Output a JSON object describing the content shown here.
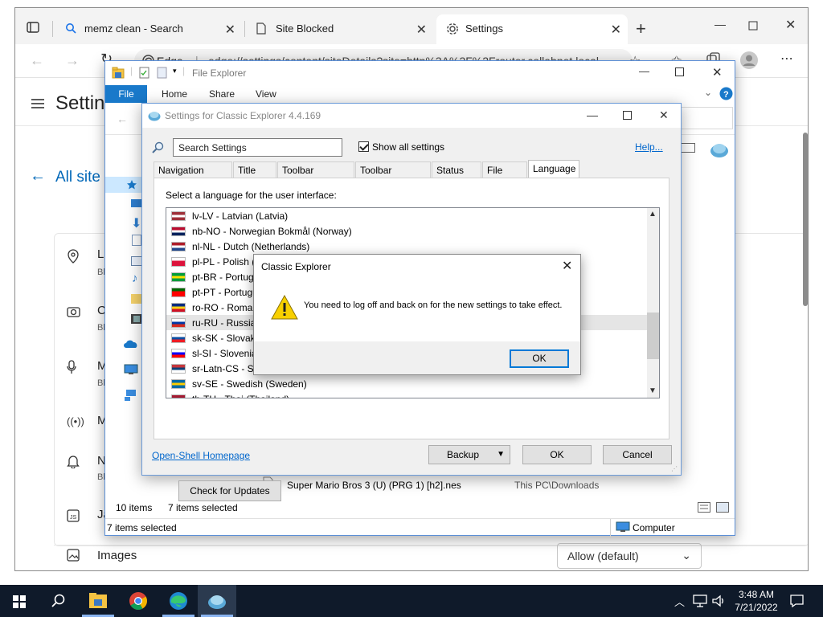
{
  "browser": {
    "tabs": [
      {
        "label": "memz clean - Search",
        "icon": "search-icon"
      },
      {
        "label": "Site Blocked",
        "icon": "page-icon"
      },
      {
        "label": "Settings",
        "icon": "gear-icon"
      }
    ],
    "address": {
      "brand": "Edge",
      "url": "edge://settings/content/siteDetails?site=http%3A%2F%2Frouter.collabnet.local"
    },
    "settings_title": "Settin",
    "all_sites": "All site",
    "permissions": [
      {
        "label": "Lo",
        "sub": "Bl"
      },
      {
        "label": "C",
        "sub": "Bl"
      },
      {
        "label": "M",
        "sub": "Bl"
      },
      {
        "label": "M",
        "sub": ""
      },
      {
        "label": "N",
        "sub": "Bl"
      },
      {
        "label": "Ja",
        "sub": ""
      }
    ],
    "images_label": "Images",
    "images_value": "Allow (default)"
  },
  "file_explorer": {
    "title": "File Explorer",
    "ribbon": {
      "file": "File",
      "home": "Home",
      "share": "Share",
      "view": "View"
    },
    "row_name": "Super Mario Bros 3 (U) (PRG 1) [h2].nes",
    "row_location": "This PC\\Downloads",
    "item_count": "10 items",
    "selected_count": "7 items selected",
    "status_selected": "7 items selected",
    "status_location": "Computer"
  },
  "classic_settings": {
    "title": "Settings for Classic Explorer 4.4.169",
    "search_placeholder": "Search Settings",
    "show_all": "Show all settings",
    "help": "Help...",
    "tabs": [
      "Navigation Pane",
      "Title Bar",
      "Toolbar Settings",
      "Toolbar Buttons",
      "Status Bar",
      "File Pane",
      "Language"
    ],
    "prompt": "Select a language for the user interface:",
    "languages": [
      {
        "label": "lv-LV - Latvian (Latvia)",
        "flag": [
          "#9e3039",
          "#ffffff",
          "#9e3039"
        ]
      },
      {
        "label": "nb-NO - Norwegian Bokmål (Norway)",
        "flag": [
          "#ba0c2f",
          "#ffffff",
          "#00205b"
        ]
      },
      {
        "label": "nl-NL - Dutch (Netherlands)",
        "flag": [
          "#ae1c28",
          "#ffffff",
          "#21468b"
        ]
      },
      {
        "label": "pl-PL - Polish (",
        "flag": [
          "#ffffff",
          "#dc143c",
          "#dc143c"
        ]
      },
      {
        "label": "pt-BR - Portugu",
        "flag": [
          "#009c3b",
          "#ffdf00",
          "#009c3b"
        ]
      },
      {
        "label": "pt-PT - Portugu",
        "flag": [
          "#006600",
          "#ff0000",
          "#ff0000"
        ]
      },
      {
        "label": "ro-RO - Roman",
        "flag": [
          "#002b7f",
          "#fcd116",
          "#ce1126"
        ]
      },
      {
        "label": "ru-RU - Russian",
        "flag": [
          "#ffffff",
          "#0039a6",
          "#d52b1e"
        ]
      },
      {
        "label": "sk-SK - Slovak (",
        "flag": [
          "#ffffff",
          "#0b4ea2",
          "#ee1c25"
        ]
      },
      {
        "label": "sl-SI - Slovenian",
        "flag": [
          "#ffffff",
          "#0000ff",
          "#ff0000"
        ]
      },
      {
        "label": "sr-Latn-CS - Se",
        "flag": [
          "#c6363c",
          "#0c4076",
          "#ffffff"
        ]
      },
      {
        "label": "sv-SE - Swedish (Sweden)",
        "flag": [
          "#006aa7",
          "#fecc00",
          "#006aa7"
        ]
      },
      {
        "label": "th-TH - Thai (Thailand)",
        "flag": [
          "#a51931",
          "#f4f5f8",
          "#2d2a4a"
        ]
      }
    ],
    "selected_language_index": 7,
    "check_updates": "Check for Updates",
    "homepage": "Open-Shell Homepage",
    "backup": "Backup",
    "ok": "OK",
    "cancel": "Cancel"
  },
  "message_box": {
    "title": "Classic Explorer",
    "text": "You need to log off and back on for the new settings to take effect.",
    "ok": "OK"
  },
  "taskbar": {
    "apps": [
      "start-icon",
      "search-icon",
      "file-explorer-icon",
      "chrome-icon",
      "edge-icon",
      "classic-shell-icon"
    ],
    "time": "3:48 AM",
    "date": "7/21/2022"
  },
  "colors": {
    "accent": "#0078d7",
    "link": "#0066cc",
    "taskbar": "#0f1a2a"
  }
}
